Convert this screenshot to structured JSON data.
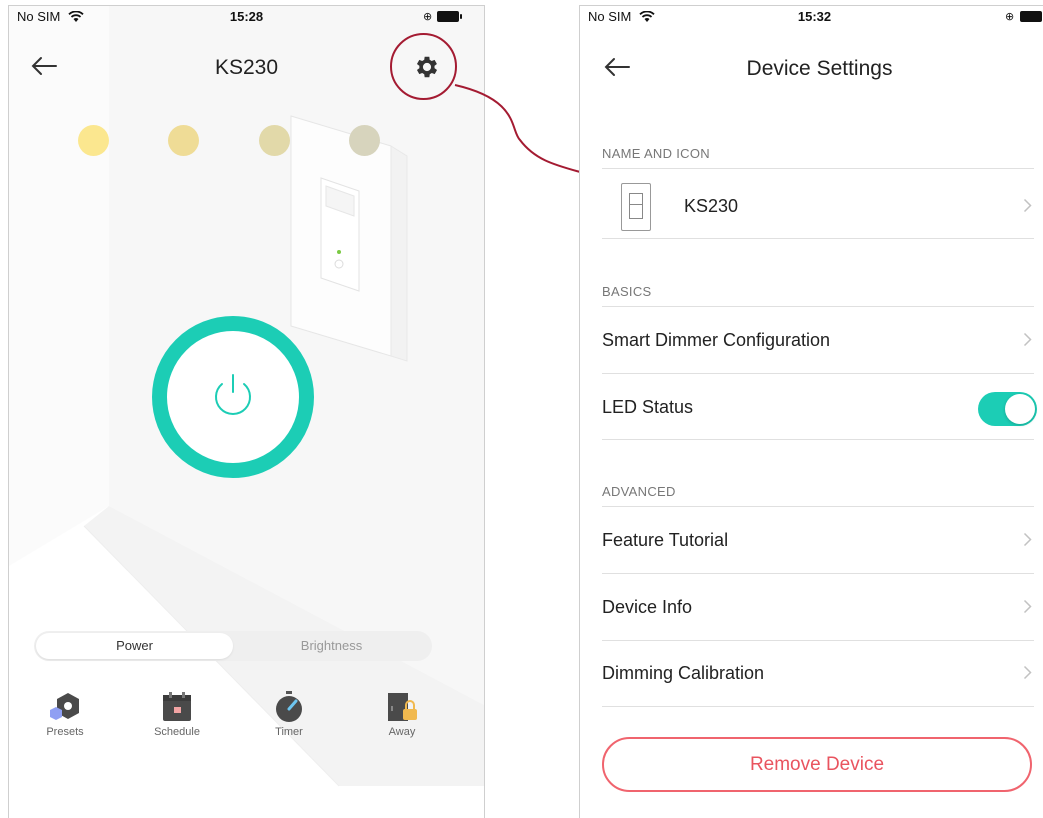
{
  "left_screen": {
    "status_bar": {
      "carrier": "No SIM",
      "time": "15:28"
    },
    "title": "KS230",
    "back_icon": "arrow-left-icon",
    "settings_icon": "gear-icon",
    "brightness_dots": [
      "#fbe78f",
      "#efdc96",
      "#e2d9a9",
      "#d7d4bd"
    ],
    "power_ring_color": "#1ccdb5",
    "mode_tabs": {
      "active": "Power",
      "inactive": "Brightness"
    },
    "toolbar": [
      {
        "label": "Presets",
        "icon": "presets-icon"
      },
      {
        "label": "Schedule",
        "icon": "calendar-icon"
      },
      {
        "label": "Timer",
        "icon": "timer-icon"
      },
      {
        "label": "Away",
        "icon": "away-lock-icon"
      }
    ]
  },
  "annotation": {
    "color": "#a41b32"
  },
  "right_screen": {
    "status_bar": {
      "carrier": "No SIM",
      "time": "15:32"
    },
    "title": "Device Settings",
    "back_icon": "arrow-left-icon",
    "sections": {
      "name_and_icon": {
        "header": "NAME AND ICON",
        "device_name": "KS230"
      },
      "basics": {
        "header": "BASICS",
        "smart_dimmer": "Smart Dimmer Configuration",
        "led_status": "LED Status",
        "led_status_on": true
      },
      "advanced": {
        "header": "ADVANCED",
        "feature_tutorial": "Feature Tutorial",
        "device_info": "Device Info",
        "dimming_calibration": "Dimming Calibration"
      }
    },
    "remove_button": "Remove Device",
    "accent_color": "#1ccdb5",
    "danger_color": "#e9545f"
  }
}
